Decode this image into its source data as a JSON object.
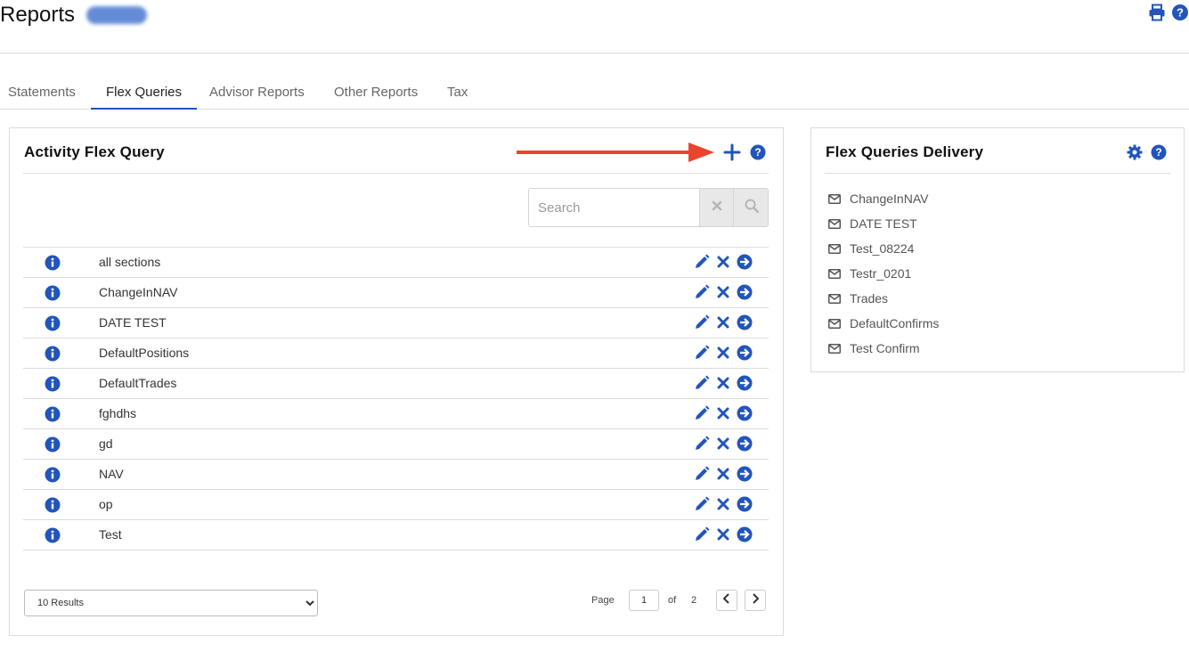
{
  "header": {
    "title": "Reports",
    "icons": [
      "print-icon",
      "help-icon"
    ],
    "accent": "#2255bb"
  },
  "tabs": [
    {
      "label": "Statements",
      "active": false
    },
    {
      "label": "Flex Queries",
      "active": true
    },
    {
      "label": "Advisor Reports",
      "active": false
    },
    {
      "label": "Other Reports",
      "active": false
    },
    {
      "label": "Tax",
      "active": false
    }
  ],
  "activity_panel": {
    "title": "Activity Flex Query",
    "search": {
      "placeholder": "Search",
      "value": ""
    },
    "rows": [
      {
        "name": "all sections"
      },
      {
        "name": "ChangeInNAV"
      },
      {
        "name": "DATE TEST"
      },
      {
        "name": "DefaultPositions"
      },
      {
        "name": "DefaultTrades"
      },
      {
        "name": "fghdhs"
      },
      {
        "name": "gd"
      },
      {
        "name": "NAV"
      },
      {
        "name": "op"
      },
      {
        "name": "Test"
      }
    ],
    "results_option": "10 Results",
    "pagination": {
      "page_label": "Page",
      "current_page": "1",
      "of_label": "of",
      "total_pages": "2"
    }
  },
  "delivery_panel": {
    "title": "Flex Queries Delivery",
    "items": [
      "ChangeInNAV",
      "DATE TEST",
      "Test_08224",
      "Testr_0201",
      "Trades",
      "DefaultConfirms",
      "Test Confirm"
    ]
  },
  "colors": {
    "icon_blue": "#2255bb",
    "annotation_arrow": "#e8452c"
  }
}
